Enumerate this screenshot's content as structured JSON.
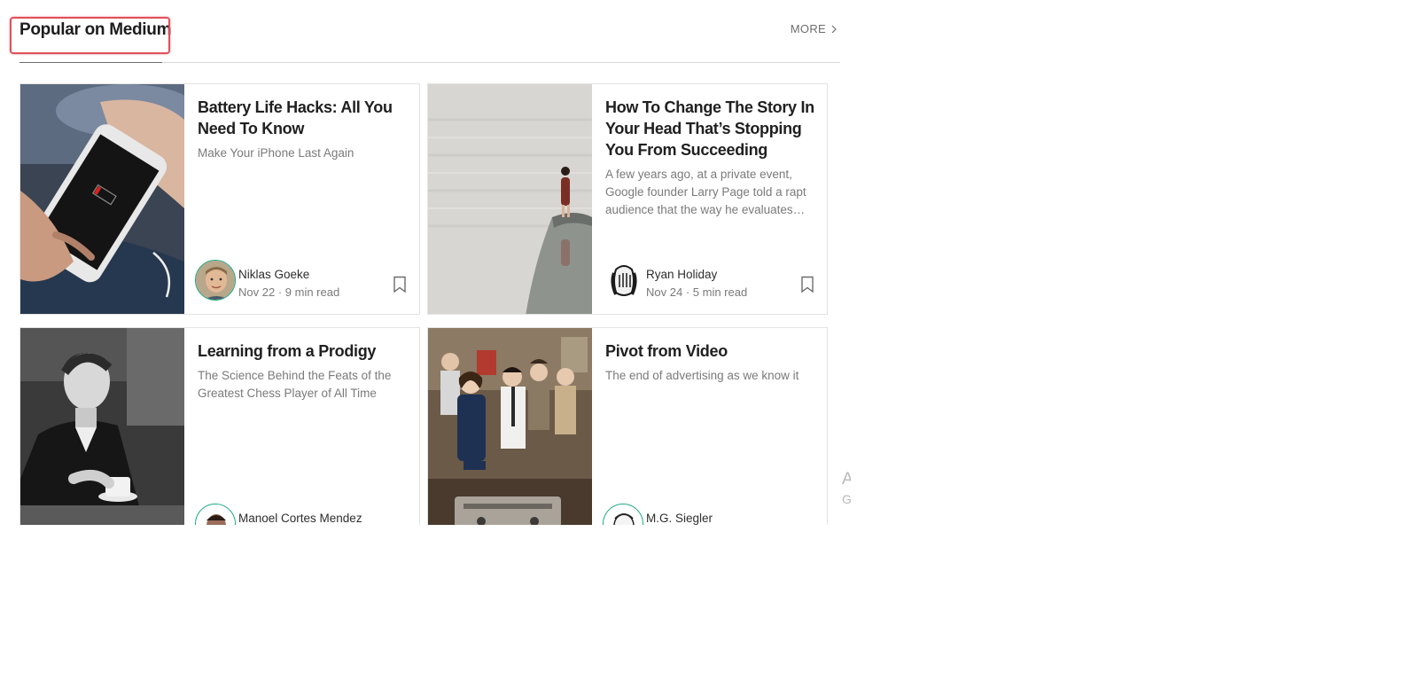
{
  "section": {
    "title": "Popular on Medium",
    "more_label": "MORE"
  },
  "cards": [
    {
      "title": "Battery Life Hacks: All You Need To Know",
      "subtitle": "Make Your iPhone Last Again",
      "author": "Niklas Goeke",
      "date": "Nov 22",
      "read_time": "9 min read",
      "image": "phone-low-battery-photo"
    },
    {
      "title": "How To Change The Story In Your Head That’s Stopping You From Succeeding",
      "subtitle": "A few years ago, at a private event, Google founder Larry Page told a rapt audience that the way he evaluates…",
      "author": "Ryan Holiday",
      "date": "Nov 24",
      "read_time": "5 min read",
      "image": "woman-standing-by-lake-photo"
    },
    {
      "title": "Learning from a Prodigy",
      "subtitle": "The Science Behind the Feats of the Greatest Chess Player of All Time",
      "author": "Manoel Cortes Mendez",
      "image": "young-man-with-teacup-photo"
    },
    {
      "title": "Pivot from Video",
      "subtitle": "The end of advertising as we know it",
      "author": "M.G. Siegler",
      "image": "mad-men-group-photo"
    }
  ],
  "watermark": {
    "line1": "Ac",
    "line2": "Go"
  },
  "colors": {
    "accent_green": "#1aa882",
    "highlight_red": "#e0505a",
    "text_dark": "#202020",
    "text_muted": "#7a7a7a"
  },
  "icons": [
    "chevron-right-icon",
    "bookmark-icon"
  ]
}
